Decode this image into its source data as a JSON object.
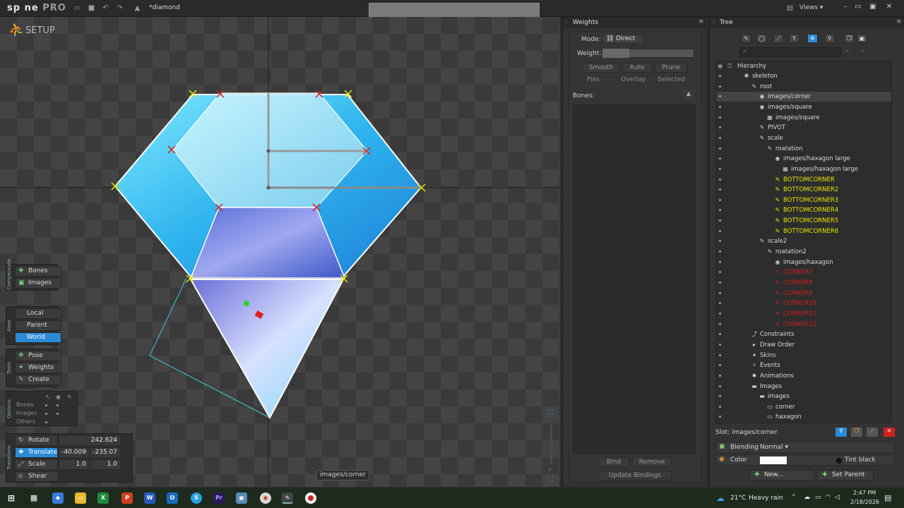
{
  "app": {
    "logo": "sp ne",
    "logo_suffix": "PRO",
    "project_name": "*diamond",
    "views_label": "Views"
  },
  "viewport": {
    "mode_label": "SETUP",
    "tooltip": "images/corner"
  },
  "left_panels": {
    "compensate": {
      "label": "Compensate",
      "buttons": [
        {
          "label": "Bones",
          "active": false
        },
        {
          "label": "Images",
          "active": false
        }
      ]
    },
    "axes": {
      "label": "Axes",
      "buttons": [
        {
          "label": "Local",
          "active": false
        },
        {
          "label": "Parent",
          "active": false
        },
        {
          "label": "World",
          "active": true
        }
      ]
    },
    "tools": {
      "label": "Tools",
      "buttons": [
        {
          "label": "Pose",
          "active": false
        },
        {
          "label": "Weights",
          "active": false
        },
        {
          "label": "Create",
          "active": false
        }
      ]
    },
    "options": {
      "label": "Options",
      "rows": [
        "Bones",
        "Images",
        "Others"
      ]
    },
    "transform": {
      "label": "Transform",
      "rotate": {
        "label": "Rotate",
        "value": "242.624"
      },
      "translate": {
        "label": "Translate",
        "x": "-40.009",
        "y": "-235.07"
      },
      "scale": {
        "label": "Scale",
        "x": "1.0",
        "y": "1.0"
      },
      "shear": {
        "label": "Shear"
      }
    }
  },
  "weights_panel": {
    "title": "Weights",
    "mode_label": "Mode:",
    "mode_value": "Direct",
    "weight_label": "Weight:",
    "smooth": "Smooth",
    "auto": "Auto",
    "prune": "Prune",
    "pies": "Pies",
    "overlay": "Overlay",
    "selected": "Selected",
    "bones_label": "Bones:",
    "bind": "Bind",
    "remove": "Remove",
    "update_bindings": "Update Bindings"
  },
  "tree_panel": {
    "title": "Tree",
    "hierarchy_label": "Hierarchy",
    "nodes": [
      {
        "label": "skeleton",
        "icon": "person-icon",
        "color": "normal",
        "indent": 0
      },
      {
        "label": "root",
        "icon": "bone-icon",
        "color": "normal",
        "indent": 1
      },
      {
        "label": "images/corner",
        "icon": "slot-icon",
        "color": "normal",
        "indent": 2,
        "selected": true
      },
      {
        "label": "images/square",
        "icon": "slot-icon",
        "color": "normal",
        "indent": 2
      },
      {
        "label": "images/square",
        "icon": "mesh-icon",
        "color": "normal",
        "indent": 3
      },
      {
        "label": "PIVOT",
        "icon": "bone-icon",
        "color": "normal",
        "indent": 2
      },
      {
        "label": "scale",
        "icon": "bone-icon",
        "color": "normal",
        "indent": 2
      },
      {
        "label": "roatation",
        "icon": "bone-icon",
        "color": "normal",
        "indent": 3
      },
      {
        "label": "images/haxagon large",
        "icon": "slot-icon",
        "color": "normal",
        "indent": 4
      },
      {
        "label": "images/haxagon large",
        "icon": "mesh-icon",
        "color": "normal",
        "indent": 5
      },
      {
        "label": "BOTTOMCORNER",
        "icon": "bone-icon",
        "color": "yellow",
        "indent": 4
      },
      {
        "label": "BOTTOMCORNER2",
        "icon": "bone-icon",
        "color": "yellow",
        "indent": 4
      },
      {
        "label": "BOTTOMCORNER3",
        "icon": "bone-icon",
        "color": "yellow",
        "indent": 4
      },
      {
        "label": "BOTTOMCORNER4",
        "icon": "bone-icon",
        "color": "yellow",
        "indent": 4
      },
      {
        "label": "BOTTOMCORNER5",
        "icon": "bone-icon",
        "color": "yellow",
        "indent": 4
      },
      {
        "label": "BOTTOMCORNER6",
        "icon": "bone-icon",
        "color": "yellow",
        "indent": 4
      },
      {
        "label": "scale2",
        "icon": "bone-icon",
        "color": "normal",
        "indent": 2
      },
      {
        "label": "roatation2",
        "icon": "bone-icon",
        "color": "normal",
        "indent": 3
      },
      {
        "label": "images/haxagon",
        "icon": "slot-icon",
        "color": "normal",
        "indent": 4
      },
      {
        "label": "CORNER7",
        "icon": "bone-icon",
        "color": "red",
        "indent": 4
      },
      {
        "label": "CORNER8",
        "icon": "bone-icon",
        "color": "red",
        "indent": 4
      },
      {
        "label": "CORNER9",
        "icon": "bone-icon",
        "color": "red",
        "indent": 4
      },
      {
        "label": "CORNER10",
        "icon": "bone-icon",
        "color": "red",
        "indent": 4
      },
      {
        "label": "CORNER11",
        "icon": "bone-icon",
        "color": "red",
        "indent": 4
      },
      {
        "label": "CORNER12",
        "icon": "bone-icon",
        "color": "red",
        "indent": 4
      },
      {
        "label": "Constraints",
        "icon": "constraint-icon",
        "color": "normal",
        "indent": 1
      },
      {
        "label": "Draw Order",
        "icon": "draw-order-icon",
        "color": "normal",
        "indent": 1
      },
      {
        "label": "Skins",
        "icon": "skins-icon",
        "color": "normal",
        "indent": 1
      },
      {
        "label": "Events",
        "icon": "events-icon",
        "color": "normal",
        "indent": 1
      },
      {
        "label": "Animations",
        "icon": "animations-icon",
        "color": "normal",
        "indent": 1
      },
      {
        "label": "Images",
        "icon": "folder-icon",
        "color": "normal",
        "indent": 1
      },
      {
        "label": "images",
        "icon": "folder-icon",
        "color": "normal",
        "indent": 2
      },
      {
        "label": "corner",
        "icon": "image-icon",
        "color": "normal",
        "indent": 3
      },
      {
        "label": "haxagon",
        "icon": "image-icon",
        "color": "normal",
        "indent": 3
      }
    ],
    "slot_label": "Slot: images/corner",
    "blending_label": "Blending",
    "blending_value": "Normal",
    "color_label": "Color",
    "tint_black": "Tint black",
    "new_button": "New...",
    "set_parent_button": "Set Parent"
  },
  "taskbar": {
    "weather_temp": "21°C",
    "weather_text": "Heavy rain",
    "time": "2:47 PM",
    "date": "2/18/2026"
  },
  "colors": {
    "accent": "#2a8ad8",
    "yellow_bone": "#e6e600",
    "red_bone": "#d02020"
  }
}
